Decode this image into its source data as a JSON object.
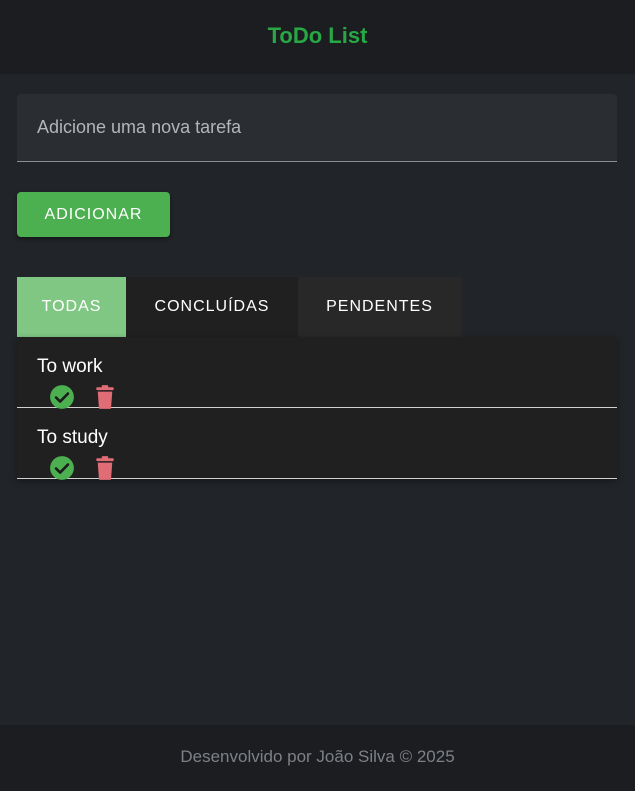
{
  "header": {
    "title": "ToDo List"
  },
  "input": {
    "placeholder": "Adicione uma nova tarefa",
    "value": ""
  },
  "add_button": {
    "label": "ADICIONAR"
  },
  "tabs": [
    {
      "label": "TODAS",
      "active": true
    },
    {
      "label": "CONCLUÍDAS",
      "active": false
    },
    {
      "label": "PENDENTES",
      "active": false
    }
  ],
  "tasks": [
    {
      "text": "To work",
      "icons": [
        "check-circle-icon",
        "trash-icon"
      ]
    },
    {
      "text": "To study",
      "icons": [
        "check-circle-icon",
        "trash-icon"
      ]
    }
  ],
  "footer": {
    "text": "Desenvolvido por João Silva © 2025"
  },
  "colors": {
    "accent": "#28a745",
    "button": "#4caf50",
    "active_tab": "#81c784",
    "delete_icon": "#e06c75",
    "complete_icon": "#4caf50"
  }
}
